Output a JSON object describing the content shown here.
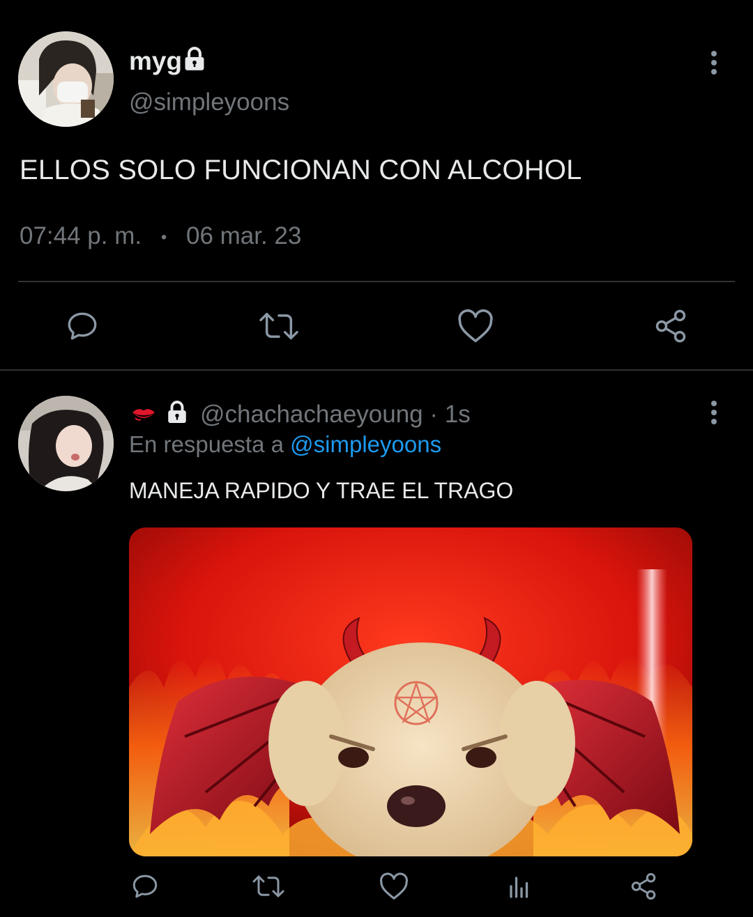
{
  "main_tweet": {
    "display_name": "myg",
    "handle": "@simpleyoons",
    "text": "ELLOS SOLO FUNCIONAN CON ALCOHOL",
    "time": "07:44 p. m.",
    "separator": "•",
    "date": "06 mar. 23",
    "protected": true
  },
  "reply_tweet": {
    "emoji": "💋",
    "handle": "@chachachaeyoung",
    "age": "· 1s",
    "reply_to_prefix": "En respuesta a",
    "reply_to_handle": "@simpleyoons",
    "text": "MANEJA RAPIDO Y TRAE EL TRAGO",
    "protected": true
  },
  "icons": {
    "reply": "reply-icon",
    "retweet": "retweet-icon",
    "like": "heart-icon",
    "share": "share-icon",
    "views": "views-icon",
    "more": "more-icon",
    "lock": "lock-icon"
  },
  "colors": {
    "background": "#000000",
    "text": "#e7e9ea",
    "secondary": "#71767b",
    "link": "#1d9bf0",
    "divider": "#2f3336",
    "icon": "#8b98a5"
  }
}
